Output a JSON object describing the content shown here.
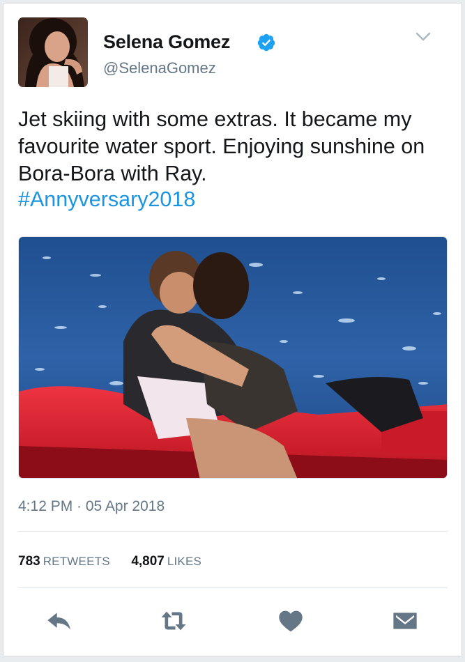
{
  "user": {
    "name": "Selena Gomez",
    "handle": "@SelenaGomez",
    "verified": true
  },
  "tweet": {
    "line1": "Jet skiing with some extras. It became my",
    "line2": "favourite water sport. Enjoying sunshine on",
    "line3": "Bora-Bora with Ray.",
    "hashtag": "#Annyversary2018",
    "timestamp": "4:12 PM · 05 Apr 2018"
  },
  "stats": {
    "retweets_count": "783",
    "retweets_label": "RETWEETS",
    "likes_count": "4,807",
    "likes_label": "LIKES"
  },
  "actions": {
    "reply_icon": "reply-icon",
    "retweet_icon": "retweet-icon",
    "like_icon": "heart-icon",
    "dm_icon": "envelope-icon"
  },
  "colors": {
    "link": "#1b95e0",
    "muted": "#657786",
    "icon": "#657786",
    "verified": "#1da1f2"
  }
}
